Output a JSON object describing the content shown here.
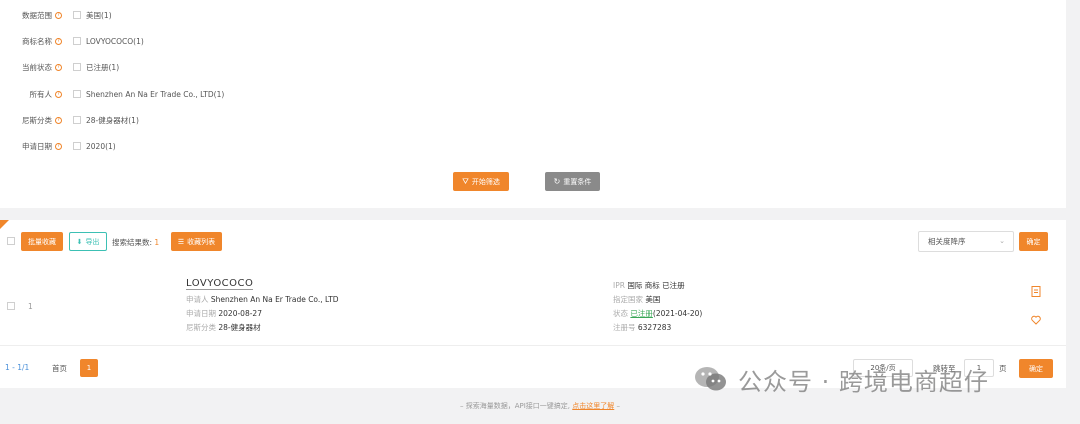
{
  "filters": [
    {
      "label": "数据范围",
      "value": "美国(1)"
    },
    {
      "label": "商标名称",
      "value": "LOVYOCOCO(1)"
    },
    {
      "label": "当前状态",
      "value": "已注册(1)"
    },
    {
      "label": "所有人",
      "value": "Shenzhen An Na Er Trade Co., LTD(1)"
    },
    {
      "label": "尼斯分类",
      "value": "28-健身器材(1)"
    },
    {
      "label": "申请日期",
      "value": "2020(1)"
    }
  ],
  "filter_actions": {
    "start": "开始筛选",
    "reset": "重置条件"
  },
  "toolbar": {
    "batch_collect": "批量收藏",
    "export": "导出",
    "result_label": "搜索结果数:",
    "result_count": "1",
    "collect_list": "收藏列表",
    "sort_value": "相关度降序",
    "confirm": "确定"
  },
  "result": {
    "index": "1",
    "name": "LOVYOCOCO",
    "applicant_label": "申请人",
    "applicant": "Shenzhen An Na Er Trade Co., LTD",
    "date_label": "申请日期",
    "date": "2020-08-27",
    "class_label": "尼斯分类",
    "class": "28-健身器材",
    "ipr_label": "IPR",
    "ipr": "国际 商标 已注册",
    "country_label": "指定国家",
    "country": "美国",
    "status_label": "状态",
    "status": "已注册",
    "status_date": "(2021-04-20)",
    "reg_label": "注册号",
    "reg_no": "6327283"
  },
  "pagination": {
    "range": "1 - 1/1",
    "first": "首页",
    "current": "1",
    "per_page": "20条/页",
    "jump_label": "跳转至",
    "jump_value": "1",
    "page_suffix": "页",
    "confirm": "确定"
  },
  "footer": {
    "text": "– 探索海量数据，API接口一键搞定,",
    "link": "点击这里了解",
    "tail": "–"
  },
  "watermark": {
    "text": "公众号 · 跨境电商超仔"
  },
  "colors": {
    "accent": "#f0862b",
    "teal": "#3cc0b4",
    "gray_button": "#8a8a8a",
    "status_green": "#3aa757"
  }
}
